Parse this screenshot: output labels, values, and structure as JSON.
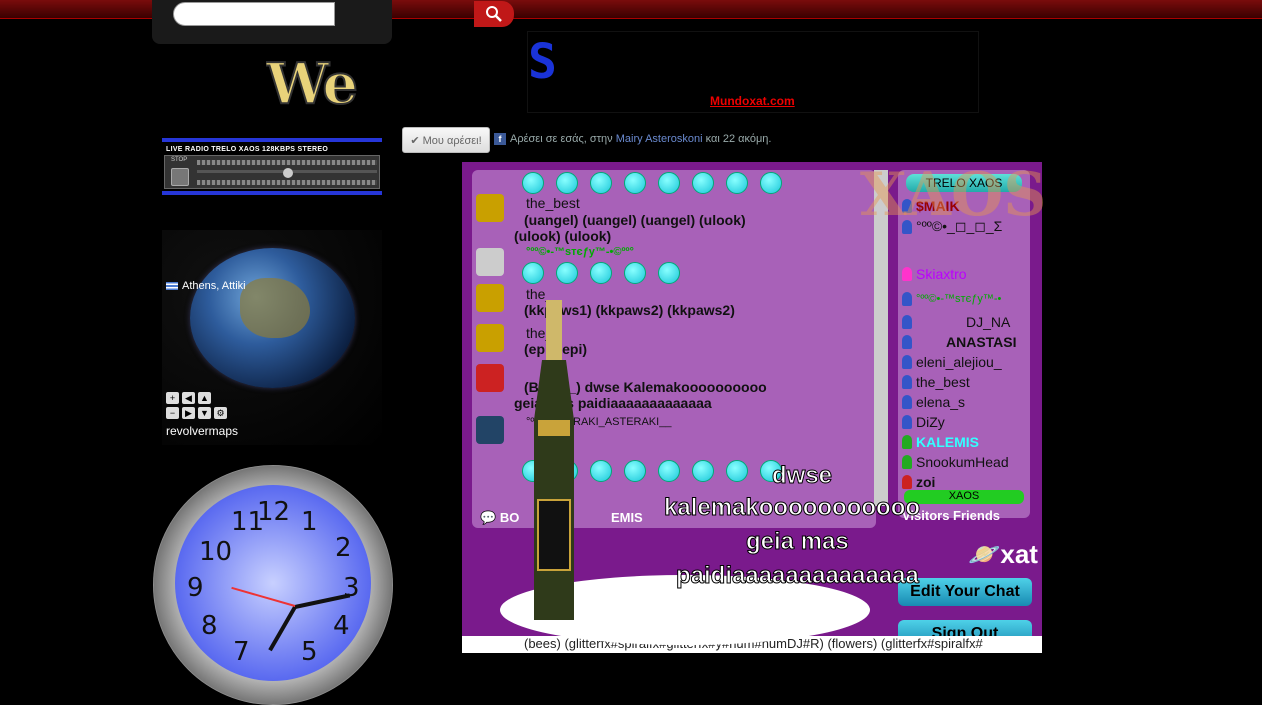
{
  "search": {
    "placeholder": "",
    "icon": "search-icon"
  },
  "logo": {
    "text": "We"
  },
  "radio": {
    "title": "LIVE RADIO TRELO XAOS 128KBPS STEREO",
    "stop_label": "STOP"
  },
  "globe": {
    "location": "Athens, Attiki",
    "credit": "revolvermaps"
  },
  "clock": {
    "numbers": [
      "11",
      "12",
      "1",
      "2",
      "3",
      "4",
      "5",
      "7",
      "8",
      "9",
      "10"
    ]
  },
  "facebook": {
    "like_label": "✔ Μου αρέσει!",
    "text_prefix": "Αρέσει σε εσάς, στην",
    "friend": "Mairy Asteroskoni",
    "text_suffix": "και 22 ακόμη."
  },
  "banner": {
    "link_text": "Mundoxat.com"
  },
  "chat": {
    "messages": [
      {
        "name": "the_best",
        "line1": "(uangel)     (uangel)     (uangel)     (ulook)",
        "line2": "(ulook)     (ulook)"
      },
      {
        "name": "°ºº©•-™sтєƒу™-•©ºº°",
        "line1": "",
        "line2": ""
      },
      {
        "name": "the_",
        "line1": "(kkpaws1)        (kkpaws2)     (kkpaws2)",
        "line2": ""
      },
      {
        "name": "the_",
        "line1": "(epi)     (epi)",
        "line2": ""
      },
      {
        "name": "Bubbl",
        "line1": "(Bubbl_) dwse Kalemakoooooooooo",
        "line2": "geia mas paidiaaaaaaaaaaaaa"
      },
      {
        "name": "°ºº©•_MARAKI_ASTERAKI__",
        "line1": "",
        "line2": ""
      }
    ],
    "pm_label": "BO",
    "pm_tail": "EMIS",
    "overlay_text": [
      "dwse",
      "kalemakooooooooooo",
      "geia mas",
      "paidiaaaaaaaaaaaaaa"
    ],
    "input_text": "(bees)   (glitterfx#spiralfx#glitterfx#y#num#numDJ#R)   (flowers)   (glitterfx#spiralfx#"
  },
  "users": {
    "group_name": "TRELO XAOS",
    "list": [
      "$MAIK",
      "°ºº©•_◻_◻_Σ",
      "Skiaxtro",
      "°ºº©•-™sтєƒу™-•",
      "DJ_NA",
      "ANASTASI",
      "eleni_alejiou_",
      "the_best",
      "elena_s",
      "DiZy",
      "KALEMIS",
      "SnookumHead",
      "zoi"
    ],
    "tab_xaos": "XAOS",
    "tabs_label": "Visitors Friends"
  },
  "actions": {
    "edit_chat": "Edit Your Chat",
    "sign_out": "Sign Out",
    "xat": "xat"
  },
  "overlay": {
    "bg_text": "XAOS"
  }
}
